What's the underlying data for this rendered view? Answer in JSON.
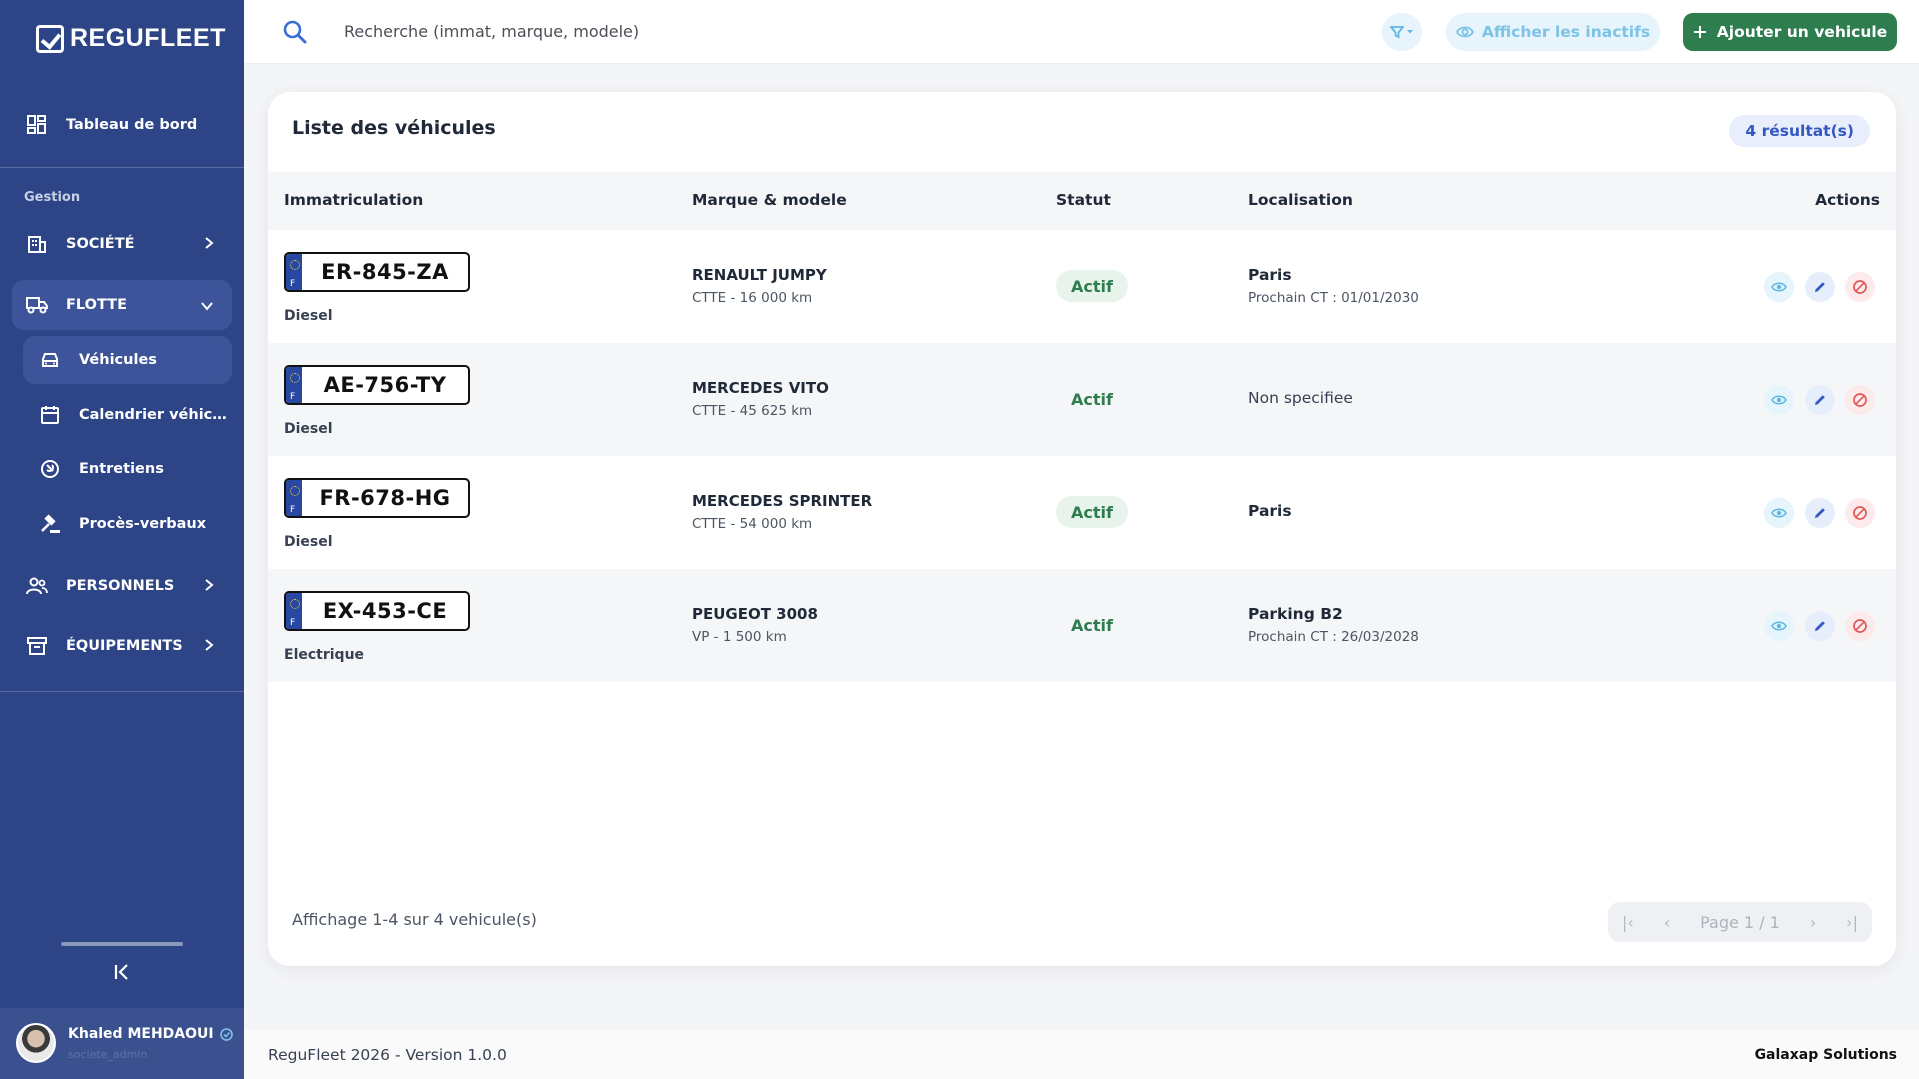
{
  "app": {
    "logo_text": "REGUFLEET"
  },
  "sidebar": {
    "dashboard_label": "Tableau de bord",
    "section_label": "Gestion",
    "societe_label": "SOCIÉTÉ",
    "flotte_label": "FLOTTE",
    "sub_items": [
      "Véhicules",
      "Calendrier véhicu...",
      "Entretiens",
      "Procès-verbaux"
    ],
    "personnels_label": "PERSONNELS",
    "equipements_label": "ÉQUIPEMENTS"
  },
  "user": {
    "name": "Khaled MEHDAOUI",
    "role": "societe_admin"
  },
  "topbar": {
    "search_placeholder": "Recherche (immat, marque, modele)",
    "inactive_label": "Afficher les inactifs",
    "add_label": "Ajouter un vehicule"
  },
  "card": {
    "title": "Liste des véhicules",
    "result_badge": "4 résultat(s)",
    "columns": [
      "Immatriculation",
      "Marque & modele",
      "Statut",
      "Localisation",
      "Actions"
    ],
    "rows": [
      {
        "plate": "ER-845-ZA",
        "plate_country": "F",
        "fuel": "Diesel",
        "model": "RENAULT JUMPY",
        "model_sub": "CTTE - 16 000 km",
        "status": "Actif",
        "location": "Paris",
        "location_sub": "Prochain CT : 01/01/2030"
      },
      {
        "plate": "AE-756-TY",
        "plate_country": "F",
        "fuel": "Diesel",
        "model": "MERCEDES VITO",
        "model_sub": "CTTE - 45 625 km",
        "status": "Actif",
        "location": "Non specifiee",
        "location_sub": ""
      },
      {
        "plate": "FR-678-HG",
        "plate_country": "F",
        "fuel": "Diesel",
        "model": "MERCEDES SPRINTER",
        "model_sub": "CTTE - 54 000 km",
        "status": "Actif",
        "location": "Paris",
        "location_sub": ""
      },
      {
        "plate": "EX-453-CE",
        "plate_country": "F",
        "fuel": "Electrique",
        "model": "PEUGEOT 3008",
        "model_sub": "VP - 1 500 km",
        "status": "Actif",
        "location": "Parking B2",
        "location_sub": "Prochain CT : 26/03/2028"
      }
    ],
    "footer_info": "Affichage 1-4 sur 4 vehicule(s)",
    "pager": {
      "first": "|‹",
      "prev": "‹",
      "page": "Page 1 / 1",
      "next": "›",
      "last": "›|"
    }
  },
  "footer": {
    "left": "ReguFleet 2026 - Version 1.0.0",
    "right": "Galaxap Solutions"
  },
  "colors": {
    "sidebar": "#2d4486",
    "active": "#3d549a",
    "primary_green": "#2e7d4f",
    "accent_blue": "#3558c4",
    "info_light": "#7cc3e6"
  }
}
